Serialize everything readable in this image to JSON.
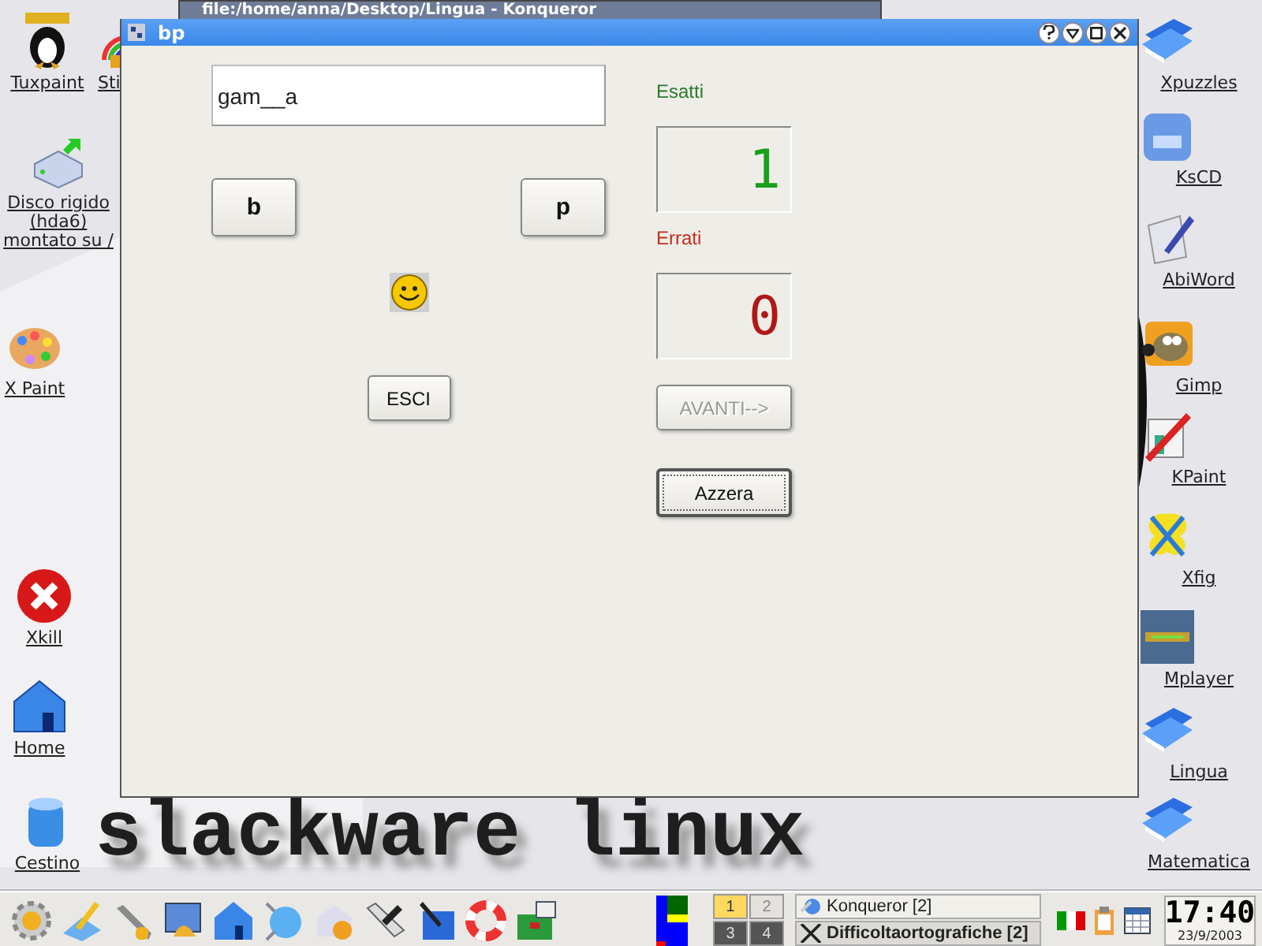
{
  "background_window": {
    "title": "file:/home/anna/Desktop/Lingua - Konqueror"
  },
  "left_icons": [
    {
      "label": "Tuxpaint",
      "kind": "tux"
    },
    {
      "label": "Sti",
      "kind": "rainbow"
    },
    {
      "label": "Disco rigido (hda6) montato su /",
      "kind": "disk"
    },
    {
      "label": "X Paint",
      "kind": "palette"
    },
    {
      "label": "Xkill",
      "kind": "xkill"
    },
    {
      "label": "Home",
      "kind": "home"
    },
    {
      "label": "Cestino",
      "kind": "trash"
    }
  ],
  "right_icons": [
    {
      "label": "Xpuzzles",
      "kind": "folder"
    },
    {
      "label": "KsCD",
      "kind": "cd"
    },
    {
      "label": "AbiWord",
      "kind": "abiword"
    },
    {
      "label": "Gimp",
      "kind": "gimp"
    },
    {
      "label": "KPaint",
      "kind": "kpaint"
    },
    {
      "label": "Xfig",
      "kind": "xfig"
    },
    {
      "label": "Mplayer",
      "kind": "mplayer"
    },
    {
      "label": "Lingua",
      "kind": "folder"
    },
    {
      "label": "Matematica",
      "kind": "folder"
    }
  ],
  "wallpaper_text": "slackware linux",
  "window": {
    "title": "bp",
    "word_field": {
      "value": "gam__a"
    },
    "letter_buttons": [
      {
        "label": "b"
      },
      {
        "label": "p"
      }
    ],
    "exit_button": {
      "label": "ESCI"
    },
    "correct": {
      "label": "Esatti",
      "count": "1"
    },
    "wrong": {
      "label": "Errati",
      "count": "0"
    },
    "next_button": {
      "label": "AVANTI-->",
      "disabled": true
    },
    "reset_button": {
      "label": "Azzera",
      "focused": true
    }
  },
  "taskbar": {
    "desktops": [
      {
        "label": "1",
        "selected": true
      },
      {
        "label": "2",
        "selected": false
      },
      {
        "label": "3",
        "selected": false
      },
      {
        "label": "4",
        "selected": false
      }
    ],
    "tasks": [
      {
        "label": "Konqueror [2]",
        "active": false,
        "kind": "konqueror"
      },
      {
        "label": "Difficoltaortografiche [2]",
        "active": true,
        "kind": "x"
      }
    ],
    "clock": {
      "time": "17:40",
      "date": "23/9/2003"
    }
  }
}
